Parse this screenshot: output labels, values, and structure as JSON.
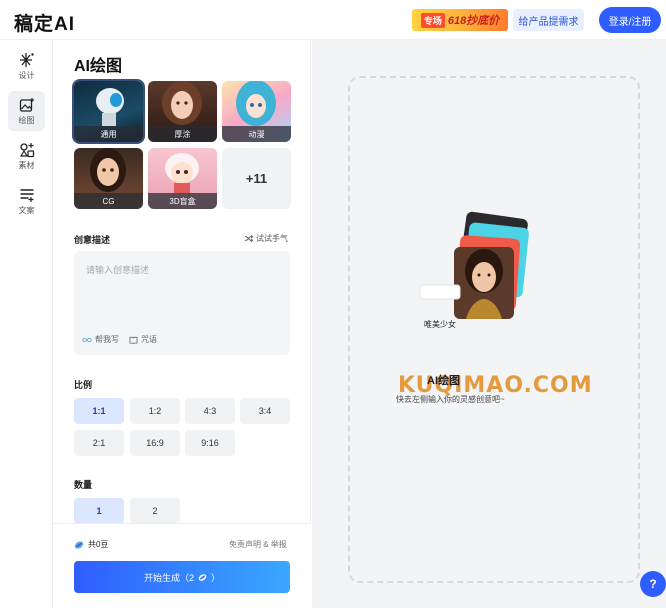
{
  "header": {
    "logo": "稿定AI",
    "promo_tag": "专场",
    "promo_text": "618抄底价",
    "request_button": "给产品提需求",
    "login_button": "登录/注册"
  },
  "rail": {
    "items": [
      {
        "label": "设计",
        "icon": "sparkle-icon"
      },
      {
        "label": "绘图",
        "icon": "image-draw-icon",
        "active": true
      },
      {
        "label": "素材",
        "icon": "assets-icon"
      },
      {
        "label": "文案",
        "icon": "text-lines-icon"
      }
    ]
  },
  "panel": {
    "title": "AI绘图",
    "styles": [
      {
        "label": "通用",
        "selected": true
      },
      {
        "label": "厚涂"
      },
      {
        "label": "动漫"
      },
      {
        "label": "CG"
      },
      {
        "label": "3D盲盒"
      }
    ],
    "more_styles": "+11",
    "prompt_section": "创意描述",
    "try_hand": "试试手气",
    "prompt_placeholder": "请输入创意描述",
    "help_write": "帮我写",
    "spell": "咒语",
    "ratio_section": "比例",
    "ratios": [
      "1:1",
      "1:2",
      "4:3",
      "3:4",
      "2:1",
      "16:9",
      "9:16"
    ],
    "selected_ratio": "1:1",
    "count_section": "数量",
    "counts": [
      "1",
      "2"
    ],
    "selected_count": "1",
    "beans": "共0豆",
    "disclaimer": "免责声明 & 举报",
    "generate": "开始生成（2",
    "generate_suffix": "）"
  },
  "canvas": {
    "bubble": "唯美少女",
    "title": "AI绘图",
    "subtitle": "快去左侧输入你的灵感创意吧~",
    "watermark": "KUQIMAO.COM",
    "help": "?"
  },
  "colors": {
    "accent": "#2f5dff",
    "selected_option": "#dde6ff"
  }
}
